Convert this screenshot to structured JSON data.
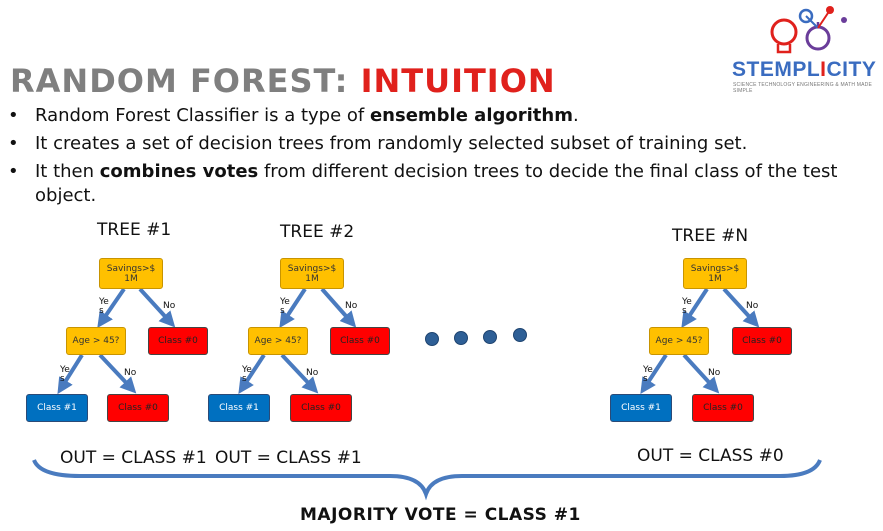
{
  "title": {
    "part1": "RANDOM FOREST: ",
    "part2": "INTUITION"
  },
  "logo": {
    "name_part1": "STEMPL",
    "name_mid": "I",
    "name_part2": "CITY",
    "tagline": "SCIENCE TECHNOLOGY ENGINEERING & MATH MADE SIMPLE"
  },
  "bullets": {
    "b1": {
      "pre": "Random Forest Classifier is a type of ",
      "bold": "ensemble algorithm",
      "post": "."
    },
    "b2": {
      "text": "It creates a set of decision trees from randomly selected subset of training set."
    },
    "b3": {
      "pre": "It then ",
      "bold": "combines votes",
      "post": " from different decision trees to decide the final class of the test object."
    }
  },
  "trees": [
    {
      "title": "TREE #1",
      "root": "Savings>$ 1M",
      "mid": "Age > 45?",
      "leaf_red_top": "Class #0",
      "leaf_blue": "Class #1",
      "leaf_red_bottom": "Class #0",
      "yes1": "Ye s",
      "no1": "No",
      "yes2": "Ye s",
      "no2": "No",
      "out": "OUT = CLASS #1"
    },
    {
      "title": "TREE #2",
      "root": "Savings>$ 1M",
      "mid": "Age > 45?",
      "leaf_red_top": "Class #0",
      "leaf_blue": "Class #1",
      "leaf_red_bottom": "Class #0",
      "yes1": "Ye s",
      "no1": "No",
      "yes2": "Ye s",
      "no2": "No",
      "out": "OUT = CLASS #1"
    },
    {
      "title": "TREE #N",
      "root": "Savings>$ 1M",
      "mid": "Age > 45?",
      "leaf_red_top": "Class #0",
      "leaf_blue": "Class #1",
      "leaf_red_bottom": "Class #0",
      "yes1": "Ye s",
      "no1": "No",
      "yes2": "Ye s",
      "no2": "No",
      "out": "OUT = CLASS #0"
    }
  ],
  "majority": "MAJORITY VOTE = CLASS #1",
  "colors": {
    "title_gray": "#7f7f7f",
    "title_red": "#e0211c",
    "node_yellow": "#ffc000",
    "node_red": "#ff0000",
    "node_blue": "#0070c0",
    "arrow": "#4a7bbf",
    "dots": "#2e5f96"
  }
}
